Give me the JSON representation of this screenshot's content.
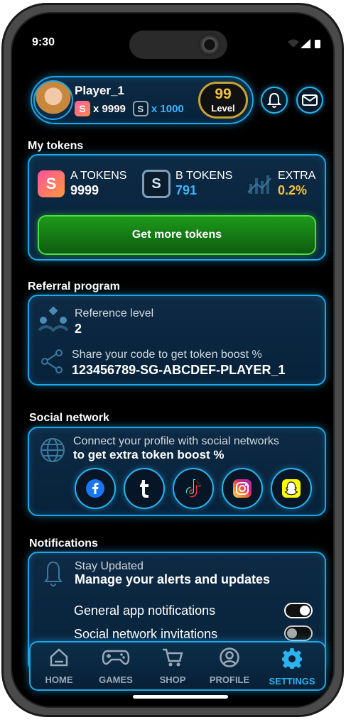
{
  "status_bar": {
    "time": "9:30"
  },
  "profile": {
    "name": "Player_1",
    "a_tokens": "x 9999",
    "b_tokens": "x 1000",
    "level_value": "99",
    "level_label": "Level",
    "a_token_glyph": "S",
    "b_token_glyph": "S"
  },
  "my_tokens": {
    "title": "My tokens",
    "a_label": "A TOKENS",
    "a_value": "9999",
    "b_label": "B TOKENS",
    "b_value": "791",
    "extra_label": "EXTRA",
    "extra_value": "0.2%",
    "cta": "Get more tokens"
  },
  "referral": {
    "title": "Referral program",
    "level_label": "Reference level",
    "level_value": "2",
    "share_label": "Share your code to get token boost %",
    "code": "123456789-SG-ABCDEF-PLAYER_1"
  },
  "social": {
    "title": "Social network",
    "line1": "Connect your profile with social networks",
    "line2": "to get extra token boost %",
    "networks": [
      "facebook",
      "tumblr",
      "tiktok",
      "instagram",
      "snapchat"
    ]
  },
  "notifications": {
    "title": "Notifications",
    "line1": "Stay Updated",
    "line2": "Manage your alerts and updates",
    "items": [
      {
        "label": "General app notifications",
        "on": true
      },
      {
        "label": "Social network invitations",
        "on": false
      }
    ]
  },
  "nav": {
    "home": "HOME",
    "games": "GAMES",
    "shop": "SHOP",
    "profile": "PROFILE",
    "settings": "SETTINGS",
    "active": "settings"
  },
  "colors": {
    "accent": "#1fa7e6",
    "gold": "#f2c43a",
    "green": "#1d9a1a",
    "b_token_value": "#3fb5ff"
  }
}
